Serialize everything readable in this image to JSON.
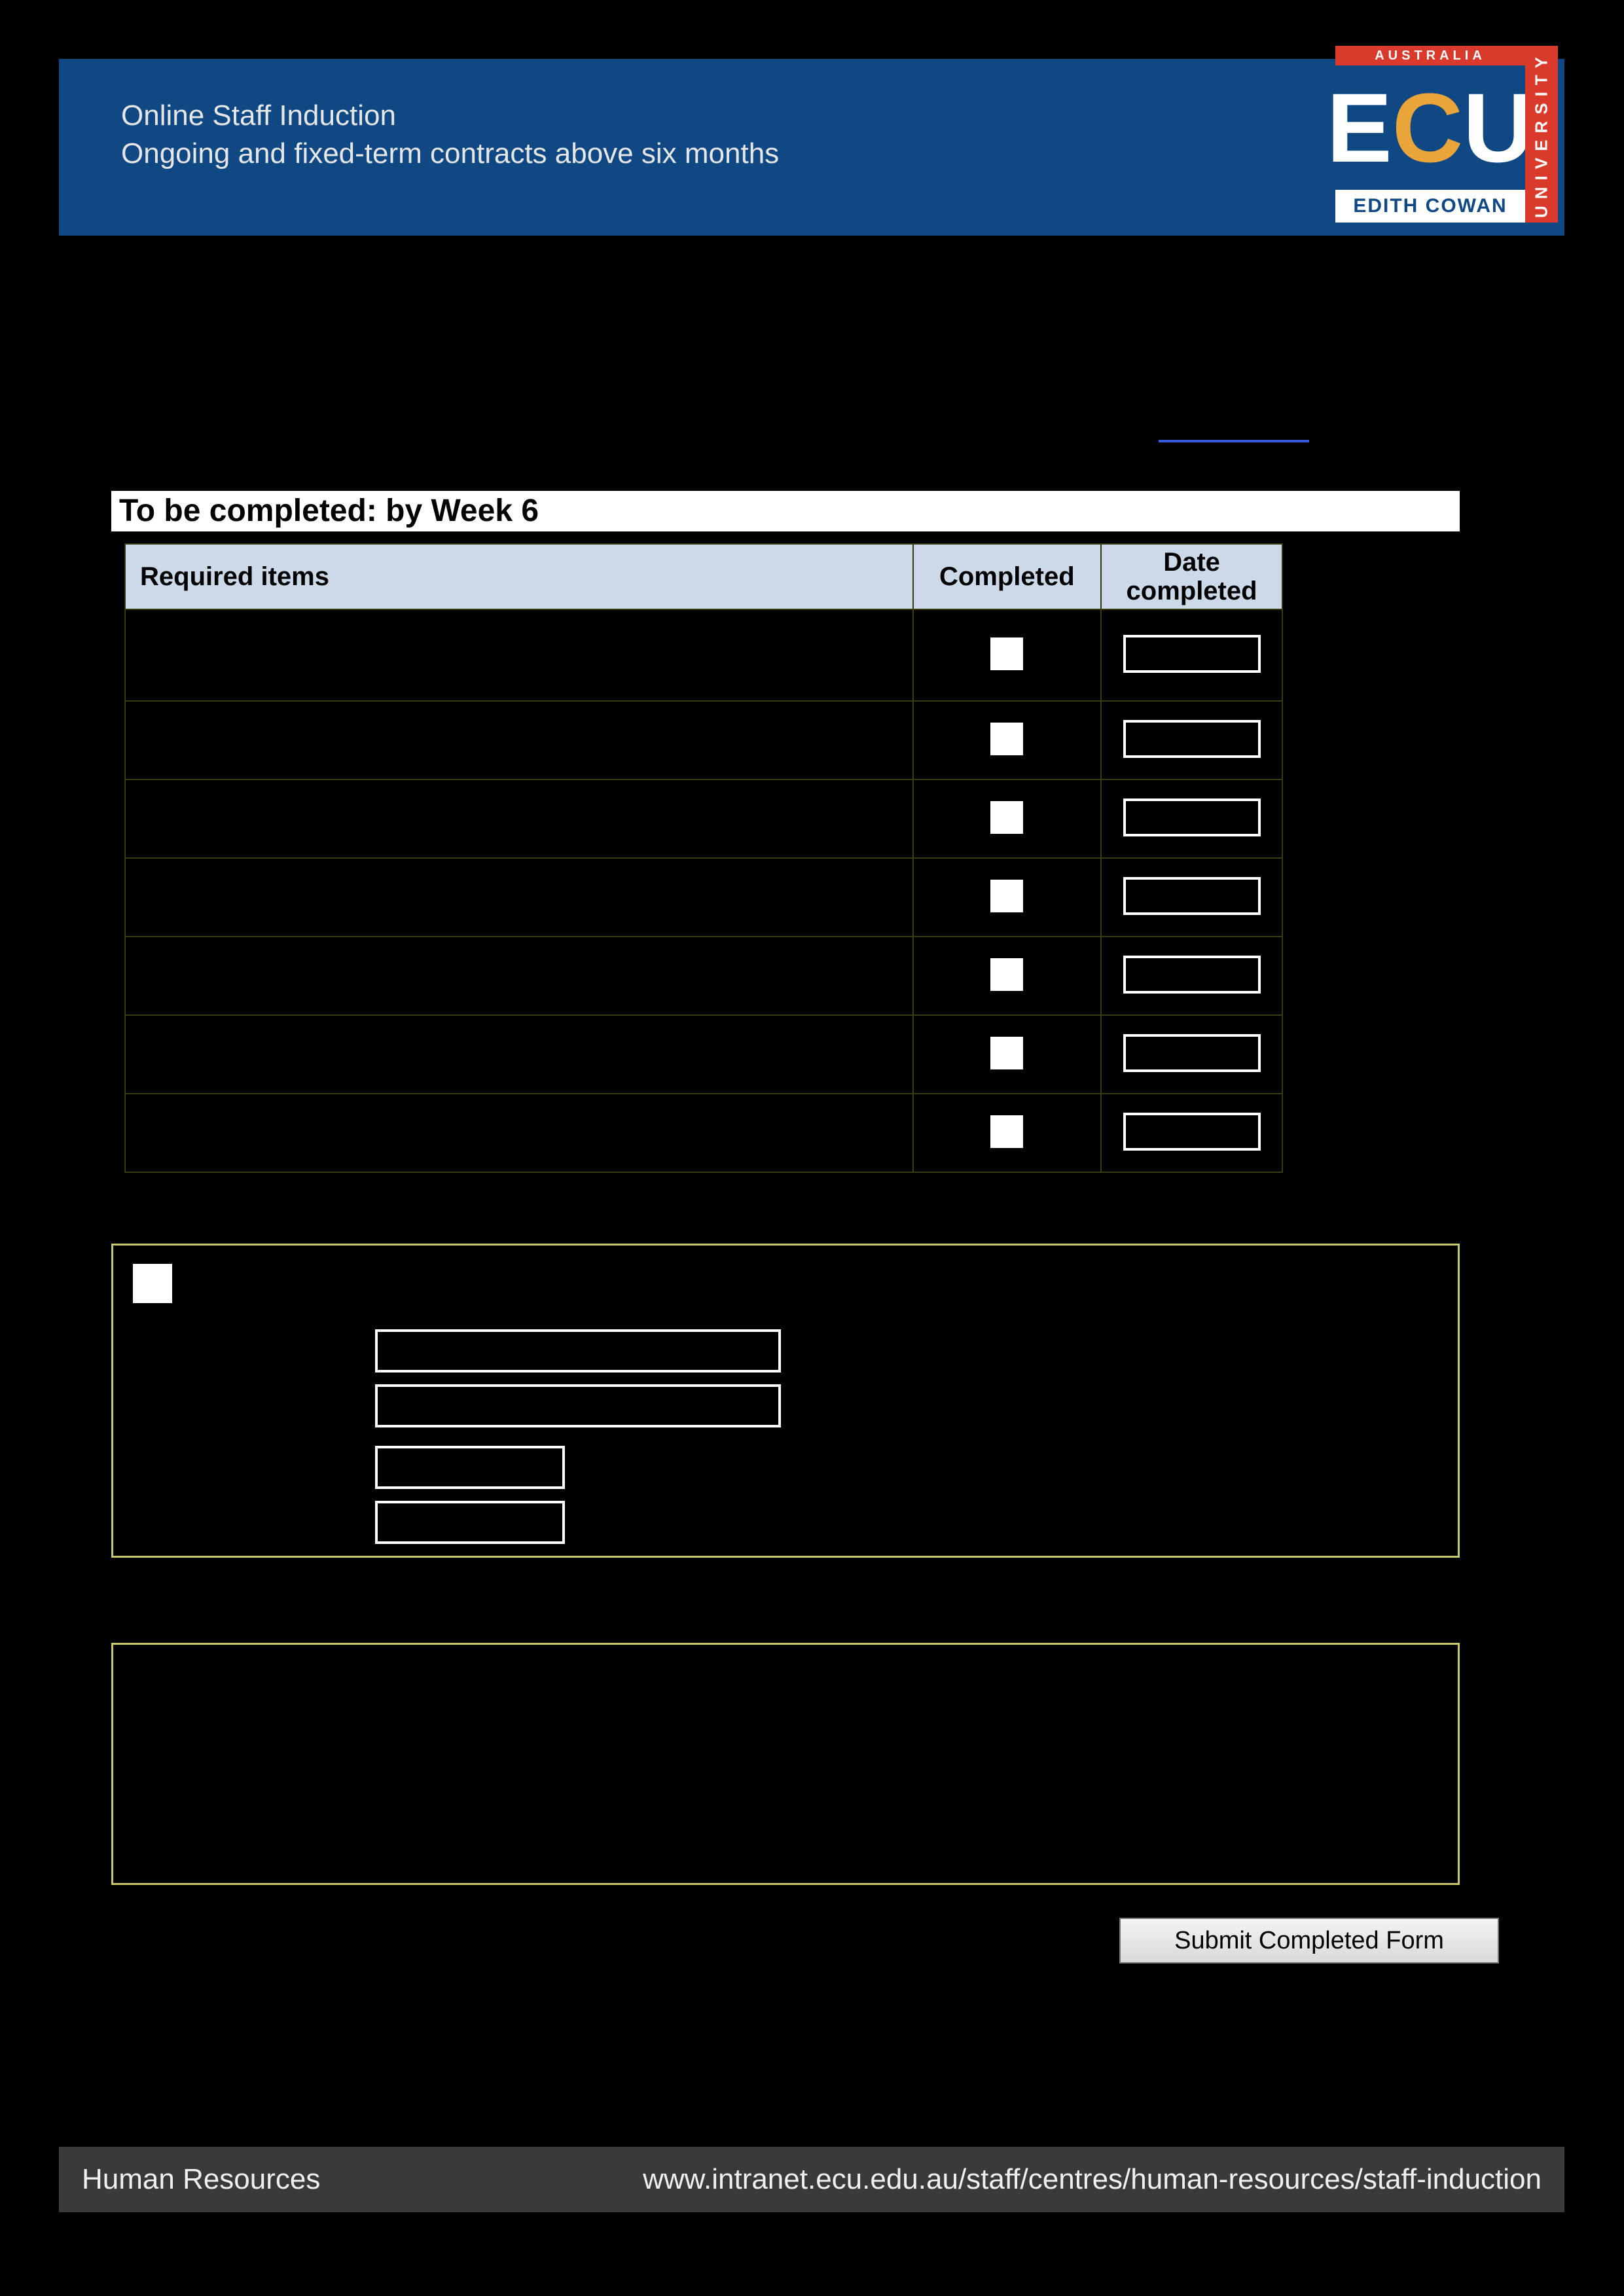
{
  "banner": {
    "title": "Online Staff Induction",
    "subtitle": "Ongoing and fixed-term contracts above six months"
  },
  "logo": {
    "top": "AUSTRALIA",
    "e": "E",
    "c": "C",
    "u": "U",
    "bottom": "EDITH COWAN",
    "side": "UNIVERSITY"
  },
  "section_heading": "To be completed: by Week 6",
  "table": {
    "headers": {
      "required": "Required items",
      "completed": "Completed",
      "date": "Date completed"
    },
    "rows": [
      {
        "item": "",
        "completed": false,
        "date": ""
      },
      {
        "item": "",
        "completed": false,
        "date": ""
      },
      {
        "item": "",
        "completed": false,
        "date": ""
      },
      {
        "item": "",
        "completed": false,
        "date": ""
      },
      {
        "item": "",
        "completed": false,
        "date": ""
      },
      {
        "item": "",
        "completed": false,
        "date": ""
      },
      {
        "item": "",
        "completed": false,
        "date": ""
      }
    ]
  },
  "confirm_panel": {
    "checkbox": false,
    "name": "",
    "position": "",
    "staff_no": "",
    "date": ""
  },
  "submit_label": "Submit Completed Form",
  "footer": {
    "left": "Human Resources",
    "right": "www.intranet.ecu.edu.au/staff/centres/human-resources/staff-induction"
  }
}
